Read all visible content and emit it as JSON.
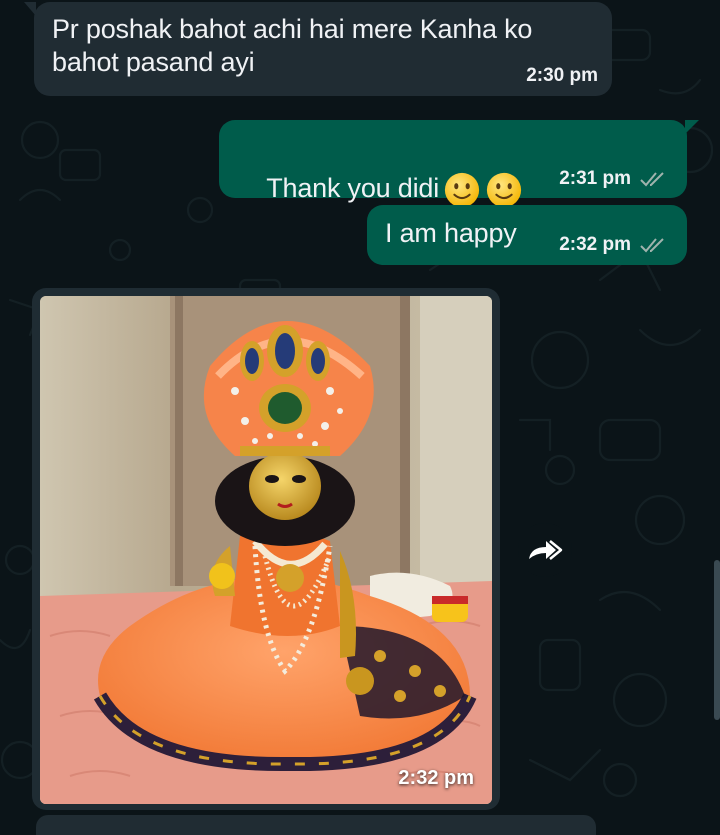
{
  "messages": [
    {
      "direction": "incoming",
      "text": "Pr poshak bahot achi hai mere Kanha ko\nbahot pasand ayi",
      "time": "2:30 pm"
    },
    {
      "direction": "outgoing",
      "text": "Thank you didi",
      "emoji": [
        "slightly-smiling-face",
        "slightly-smiling-face"
      ],
      "time": "2:31 pm",
      "status": "double-tick-read"
    },
    {
      "direction": "outgoing",
      "text": "I am happy",
      "time": "2:32 pm",
      "status": "double-tick-read"
    },
    {
      "direction": "outgoing",
      "type": "image",
      "time": "2:32 pm"
    }
  ],
  "icons": {
    "forward": "forward-icon",
    "ticks": "double-check-icon"
  },
  "colors": {
    "background": "#0b1418",
    "incoming_bubble": "#202c33",
    "outgoing_bubble": "#005c4b",
    "tick": "#9fb3ad"
  }
}
